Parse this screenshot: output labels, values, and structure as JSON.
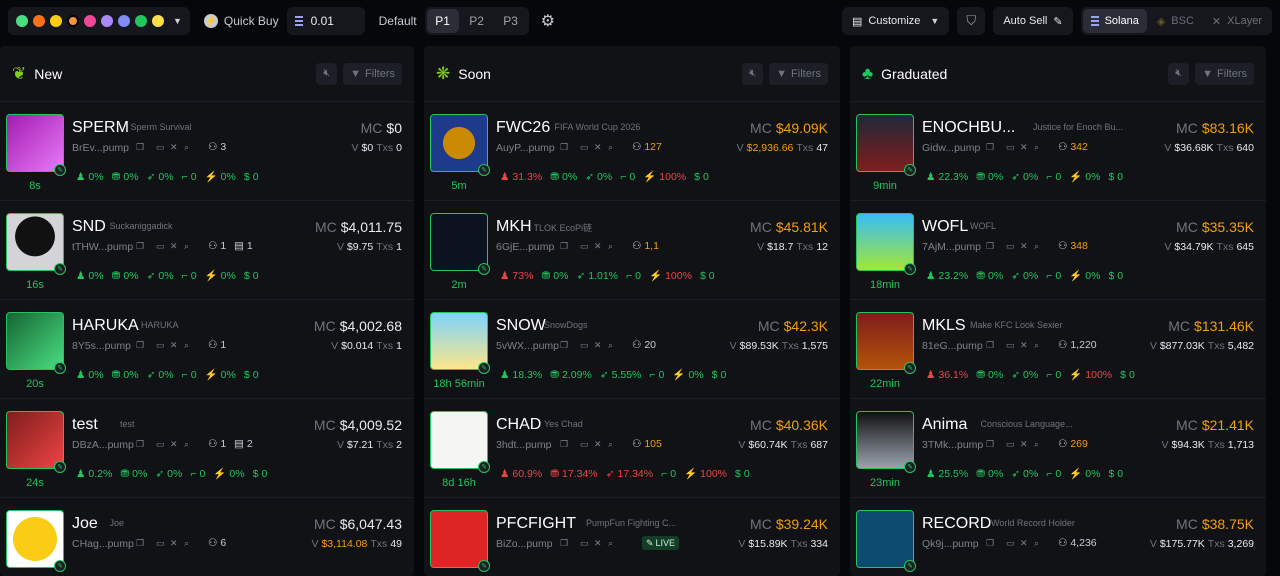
{
  "topbar": {
    "quick_buy_label": "Quick Buy",
    "quick_buy_value": "0.01",
    "default_label": "Default",
    "presets": [
      "P1",
      "P2",
      "P3"
    ],
    "customize_label": "Customize",
    "auto_sell_label": "Auto Sell",
    "chains": [
      "Solana",
      "BSC",
      "XLayer"
    ]
  },
  "columns": {
    "new": {
      "title": "New",
      "filters": "Filters",
      "rows": [
        {
          "ticker": "SPERM",
          "name": "Sperm Survival",
          "addr": "BrEv...pump",
          "holders": "3",
          "age": "8s",
          "mc": "$0",
          "v": "$0",
          "tx": "0",
          "s": [
            "0%",
            "0%",
            "0%",
            "0",
            "0%",
            "0"
          ]
        },
        {
          "ticker": "SND",
          "name": "Suckaniggadick",
          "addr": "tTHW...pump",
          "holders": "1",
          "extra": "1",
          "age": "16s",
          "mc": "$4,011.75",
          "v": "$9.75",
          "tx": "1",
          "s": [
            "0%",
            "0%",
            "0%",
            "0",
            "0%",
            "0"
          ]
        },
        {
          "ticker": "HARUKA",
          "name": "HARUKA",
          "addr": "8Y5s...pump",
          "holders": "1",
          "age": "20s",
          "mc": "$4,002.68",
          "v": "$0.014",
          "tx": "1",
          "s": [
            "0%",
            "0%",
            "0%",
            "0",
            "0%",
            "0"
          ]
        },
        {
          "ticker": "test",
          "name": "test",
          "addr": "DBzA...pump",
          "holders": "1",
          "extra": "2",
          "age": "24s",
          "mc": "$4,009.52",
          "v": "$7.21",
          "tx": "2",
          "s": [
            "0.2%",
            "0%",
            "0%",
            "0",
            "0%",
            "0"
          ]
        },
        {
          "ticker": "Joe",
          "name": "Joe",
          "addr": "CHag...pump",
          "holders": "6",
          "age": "",
          "mc": "$6,047.43",
          "v": "$3,114.08",
          "tx": "49",
          "s": [
            "",
            "",
            "",
            "",
            "",
            ""
          ]
        }
      ]
    },
    "soon": {
      "title": "Soon",
      "filters": "Filters",
      "rows": [
        {
          "ticker": "FWC26",
          "name": "FIFA World Cup 2026",
          "addr": "AuyP...pump",
          "holders": "127",
          "age": "5m",
          "mc": "$49.09K",
          "v": "$2,936.66",
          "tx": "47",
          "s": [
            "31.3%",
            "0%",
            "0%",
            "0",
            "100%",
            "0"
          ]
        },
        {
          "ticker": "MKH",
          "name": "TLOK EcoPi链",
          "addr": "6GjE...pump",
          "holders": "1,1",
          "age": "2m",
          "mc": "$45.81K",
          "v": "$18.7",
          "tx": "12",
          "s": [
            "73%",
            "0%",
            "1.01%",
            "0",
            "100%",
            "0"
          ]
        },
        {
          "ticker": "SNOW",
          "name": "SnowDogs",
          "addr": "5vWX...pump",
          "holders": "20",
          "age": "18h 56min",
          "mc": "$42.3K",
          "v": "$89.53K",
          "tx": "1,575",
          "s": [
            "18.3%",
            "2.09%",
            "5.55%",
            "0",
            "0%",
            "0"
          ]
        },
        {
          "ticker": "CHAD",
          "name": "Yes Chad",
          "addr": "3hdt...pump",
          "holders": "105",
          "age": "8d 16h",
          "mc": "$40.36K",
          "v": "$60.74K",
          "tx": "687",
          "s": [
            "60.9%",
            "17.34%",
            "17.34%",
            "0",
            "100%",
            "0"
          ]
        },
        {
          "ticker": "PFCFIGHT",
          "name": "PumpFun Fighting C...",
          "addr": "BiZo...pump",
          "holders": "",
          "live": "LIVE",
          "age": "",
          "mc": "$39.24K",
          "v": "$15.89K",
          "tx": "334",
          "s": [
            "",
            "",
            "",
            "",
            "",
            ""
          ]
        }
      ]
    },
    "graduated": {
      "title": "Graduated",
      "filters": "Filters",
      "rows": [
        {
          "ticker": "ENOCHBU...",
          "name": "Justice for Enoch Bu...",
          "addr": "Gidw...pump",
          "holders": "342",
          "age": "9min",
          "mc": "$83.16K",
          "v": "$36.68K",
          "tx": "640",
          "s": [
            "22.3%",
            "0%",
            "0%",
            "0",
            "0%",
            "0"
          ]
        },
        {
          "ticker": "WOFL",
          "name": "WOFL",
          "addr": "7AjM...pump",
          "holders": "348",
          "age": "18min",
          "mc": "$35.35K",
          "v": "$34.79K",
          "tx": "645",
          "s": [
            "23.2%",
            "0%",
            "0%",
            "0",
            "0%",
            "0"
          ]
        },
        {
          "ticker": "MKLS",
          "name": "Make KFC Look Sexier",
          "addr": "81eG...pump",
          "holders": "1,220",
          "age": "22min",
          "mc": "$131.46K",
          "v": "$877.03K",
          "tx": "5,482",
          "s": [
            "36.1%",
            "0%",
            "0%",
            "0",
            "100%",
            "0"
          ]
        },
        {
          "ticker": "Anima",
          "name": "Conscious Language...",
          "addr": "3TMk...pump",
          "holders": "269",
          "age": "23min",
          "mc": "$21.41K",
          "v": "$94.3K",
          "tx": "1,713",
          "s": [
            "25.5%",
            "0%",
            "0%",
            "0",
            "0%",
            "0"
          ]
        },
        {
          "ticker": "RECORD",
          "name": "World Record Holder",
          "addr": "Qk9j...pump",
          "holders": "4,236",
          "age": "",
          "mc": "$38.75K",
          "v": "$175.77K",
          "tx": "3,269",
          "s": [
            "",
            "",
            "",
            "",
            "",
            ""
          ]
        }
      ]
    }
  },
  "labels": {
    "mc": "MC",
    "v": "V",
    "txs": "Txs"
  },
  "colors": {
    "green": "#22c55e",
    "red": "#ef4444",
    "orange": "#f59e0b",
    "bg": "#06070a",
    "panel": "#101216"
  }
}
